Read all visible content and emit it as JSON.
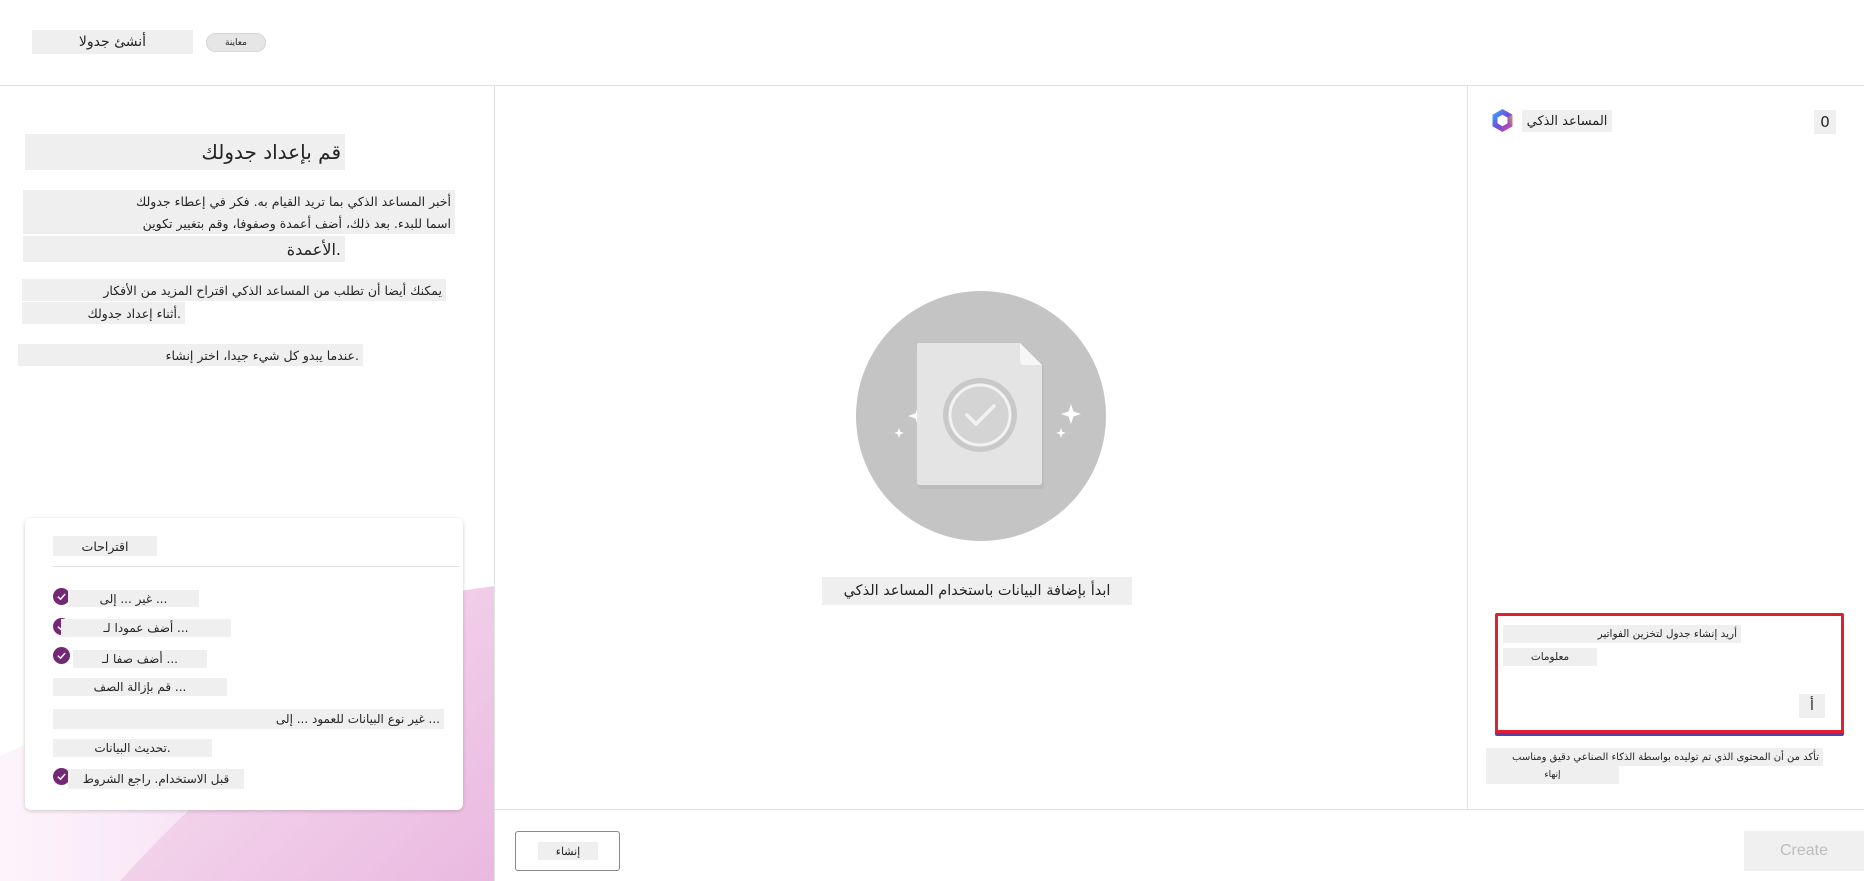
{
  "header": {
    "page_title": "أنشئ جدولا",
    "preview_badge": "معاينة"
  },
  "left_panel": {
    "heading": "قم بإعداد جدولك",
    "paragraph1": [
      "أخبر المساعد الذكي بما تريد القيام به. فكر في إعطاء جدولك",
      "اسما للبدء. بعد ذلك، أضف أعمدة وصفوفا، وقم بتغيير تكوين",
      "الأعمدة."
    ],
    "paragraph2": [
      "يمكنك أيضا أن تطلب من المساعد الذكي اقتراح المزيد من الأفكار",
      "أثناء إعداد جدولك."
    ],
    "paragraph3": "عندما يبدو كل شيء جيدا، اختر إنشاء.",
    "suggestions": {
      "title": "اقتراحات",
      "items": [
        "غير ... إلى ...",
        "أضف عمودا لـ ...",
        "أضف صفا لـ ...",
        "قم بإزالة الصف ...",
        "غير نوع البيانات للعمود ... إلى ...",
        "تحديث البيانات.",
        "قبل الاستخدام. راجع الشروط"
      ]
    }
  },
  "center": {
    "start_text": "ابدأ بإضافة البيانات باستخدام المساعد الذكي"
  },
  "right_panel": {
    "title": "المساعد الذكي",
    "counter": "0",
    "chat_input": {
      "line1": "أريد إنشاء جدول لتخزين الفواتير",
      "line2": "معلومات",
      "send_label": "أ"
    },
    "disclaimer": [
      "تأكد من أن المحتوى الذي تم توليده بواسطة الذكاء الصناعي دقيق ومناسب",
      "إنهاء"
    ]
  },
  "footer": {
    "create_ar_label": "إنشاء",
    "create_label": "Create"
  },
  "colors": {
    "accent_purple": "#742774",
    "chat_border_red": "#e0202e",
    "illustration_gray": "#c4c4c4"
  }
}
